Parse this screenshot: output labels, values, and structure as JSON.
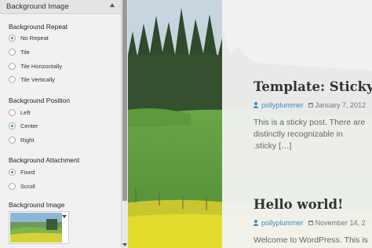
{
  "panel": {
    "title": "Background Image",
    "sections": [
      {
        "label": "Background Repeat",
        "options": [
          "No Repeat",
          "Tile",
          "Tile Horizontally",
          "Tile Vertically"
        ],
        "selected": "No Repeat"
      },
      {
        "label": "Background Position",
        "options": [
          "Left",
          "Center",
          "Right"
        ],
        "selected": "Center"
      },
      {
        "label": "Background Attachment",
        "options": [
          "Fixed",
          "Scroll"
        ],
        "selected": "Fixed"
      }
    ],
    "image_label": "Background Image"
  },
  "preview": {
    "posts": [
      {
        "title": "Template: Sticky",
        "author": "pollyplummer",
        "date": "January 7, 2012",
        "excerpt": [
          "This is a sticky post. There are",
          "distinctly recognizable in",
          ".sticky […]"
        ]
      },
      {
        "title": "Hello world!",
        "author": "pollyplummer",
        "date": "November 14, 2",
        "excerpt": [
          "Welcome to WordPress. This is"
        ]
      }
    ]
  },
  "colors": {
    "accent": "#1e8cbe",
    "link": "#3b8fc4"
  }
}
